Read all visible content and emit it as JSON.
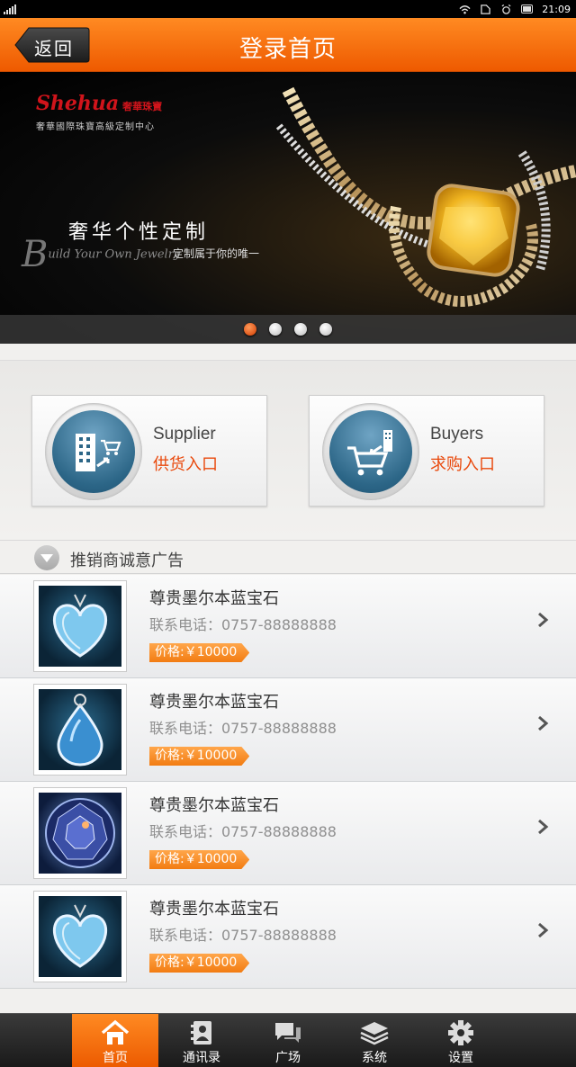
{
  "status_bar": {
    "time": "21:09"
  },
  "header": {
    "back_label": "返回",
    "title": "登录首页"
  },
  "banner": {
    "brand_name": "Shehua",
    "brand_cn": "奢華珠寶",
    "brand_sub": "奢華國際珠寶高級定制中心",
    "slogan": "奢华个性定制",
    "slogan_script": "uild Your Own Jewelry",
    "slogan_script_initial": "B",
    "slogan_sub": "定制属于你的唯一",
    "slide_count": 4,
    "active_slide": 1
  },
  "entries": {
    "supplier": {
      "en": "Supplier",
      "cn": "供货入口"
    },
    "buyers": {
      "en": "Buyers",
      "cn": "求购入口"
    }
  },
  "section": {
    "title": "推销商诚意广告"
  },
  "products": [
    {
      "title": "尊贵墨尔本蓝宝石",
      "phone": "联系电话：0757-88888888",
      "price": "价格:￥10000",
      "image": "heart-pendant"
    },
    {
      "title": "尊贵墨尔本蓝宝石",
      "phone": "联系电话：0757-88888888",
      "price": "价格:￥10000",
      "image": "drop-pendant"
    },
    {
      "title": "尊贵墨尔本蓝宝石",
      "phone": "联系电话：0757-88888888",
      "price": "价格:￥10000",
      "image": "round-gem"
    },
    {
      "title": "尊贵墨尔本蓝宝石",
      "phone": "联系电话：0757-88888888",
      "price": "价格:￥10000",
      "image": "heart-pendant"
    }
  ],
  "tabs": [
    {
      "label": "首页",
      "icon": "home-icon",
      "active": true
    },
    {
      "label": "通讯录",
      "icon": "contacts-icon",
      "active": false
    },
    {
      "label": "广场",
      "icon": "chat-icon",
      "active": false
    },
    {
      "label": "系统",
      "icon": "layers-icon",
      "active": false
    },
    {
      "label": "设置",
      "icon": "gear-icon",
      "active": false
    }
  ],
  "colors": {
    "accent": "#f26b0f",
    "entry_text": "#e9480b",
    "tabbar": "#222222"
  }
}
